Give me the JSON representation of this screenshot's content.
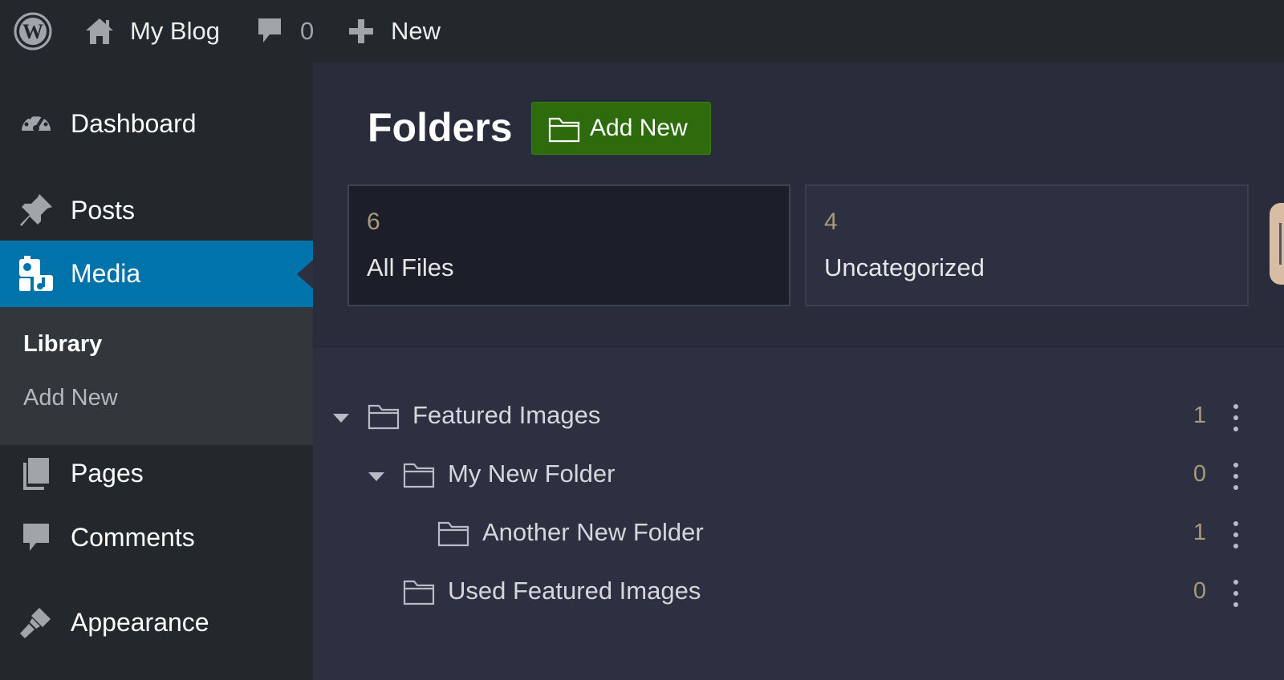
{
  "adminbar": {
    "logo_icon": "wordpress-logo-icon",
    "site_name": "My Blog",
    "comments_count": "0",
    "new_label": "New"
  },
  "sidebar": {
    "items": [
      {
        "label": "Dashboard",
        "icon": "dashboard-icon"
      },
      {
        "label": "Posts",
        "icon": "pin-icon"
      },
      {
        "label": "Media",
        "icon": "media-icon",
        "active": true
      },
      {
        "label": "Pages",
        "icon": "pages-icon"
      },
      {
        "label": "Comments",
        "icon": "comment-icon"
      },
      {
        "label": "Appearance",
        "icon": "brush-icon"
      }
    ],
    "submenu": [
      {
        "label": "Library",
        "current": true
      },
      {
        "label": "Add New"
      }
    ]
  },
  "main": {
    "title": "Folders",
    "add_new_label": "Add New",
    "stats": [
      {
        "count": "6",
        "label": "All Files",
        "selected": true
      },
      {
        "count": "4",
        "label": "Uncategorized"
      }
    ],
    "tree": [
      {
        "label": "Featured Images",
        "count": "1",
        "expanded": true
      },
      {
        "label": "My New Folder",
        "count": "0",
        "expanded": true
      },
      {
        "label": "Another New Folder",
        "count": "1"
      },
      {
        "label": "Used Featured Images",
        "count": "0"
      }
    ]
  },
  "colors": {
    "adminbar_bg": "#23282d",
    "menu_active": "#0073aa",
    "submenu_bg": "#32373c",
    "main_bg": "#2c3040",
    "add_button_bg": "#2e6b0c",
    "count_color": "#a89a7a"
  }
}
